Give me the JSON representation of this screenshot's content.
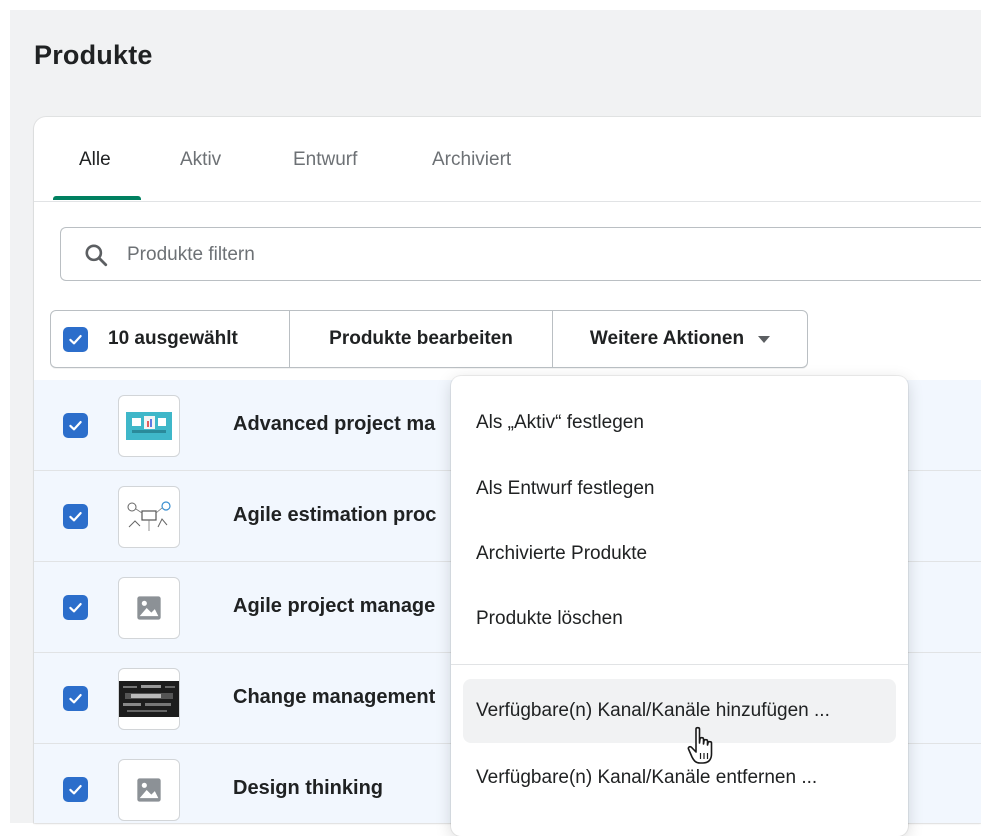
{
  "page": {
    "title": "Produkte"
  },
  "tabs": [
    {
      "label": "Alle",
      "active": true
    },
    {
      "label": "Aktiv",
      "active": false
    },
    {
      "label": "Entwurf",
      "active": false
    },
    {
      "label": "Archiviert",
      "active": false
    }
  ],
  "search": {
    "placeholder": "Produkte filtern",
    "value": ""
  },
  "bulk_actions": {
    "selected_label": "10 ausgewählt",
    "edit_label": "Produkte bearbeiten",
    "more_label": "Weitere Aktionen"
  },
  "products": [
    {
      "title": "Advanced project ma",
      "image": "dashboard-thumbnail",
      "checked": true
    },
    {
      "title": "Agile estimation proc",
      "image": "agile-sketch-thumbnail",
      "checked": true
    },
    {
      "title": "Agile project manage",
      "image": "image-placeholder-icon",
      "checked": true
    },
    {
      "title": "Change management",
      "image": "word-cloud-thumbnail",
      "checked": true
    },
    {
      "title": "Design thinking",
      "image": "image-placeholder-icon",
      "checked": true
    }
  ],
  "menu": {
    "items": [
      {
        "label": "Als „Aktiv“ festlegen"
      },
      {
        "label": "Als Entwurf festlegen"
      },
      {
        "label": "Archivierte Produkte"
      },
      {
        "label": "Produkte löschen"
      },
      {
        "label": "Verfügbare(n) Kanal/Kanäle hinzufügen ..."
      },
      {
        "label": "Verfügbare(n) Kanal/Kanäle entfernen ..."
      }
    ]
  },
  "colors": {
    "accent_tab": "#008060",
    "checkbox": "#2c6ecb",
    "row_selected_bg": "#f2f7fe",
    "page_bg": "#f1f2f3"
  }
}
